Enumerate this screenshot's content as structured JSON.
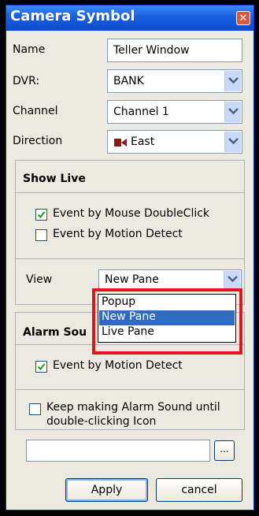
{
  "window": {
    "title": "Camera Symbol",
    "close_glyph": "✕"
  },
  "fields": {
    "name": {
      "label": "Name",
      "value": "Teller Window"
    },
    "dvr": {
      "label": "DVR:",
      "value": "BANK"
    },
    "channel": {
      "label": "Channel",
      "value": "Channel 1"
    },
    "direction": {
      "label": "Direction",
      "value": "East",
      "icon": "camera-direction-icon",
      "icon_color": "#8b1a1a"
    }
  },
  "show_live": {
    "title": "Show Live",
    "checks": [
      {
        "label": "Event by Mouse DoubleClick",
        "checked": true
      },
      {
        "label": "Event by Motion Detect",
        "checked": false
      }
    ],
    "view": {
      "label": "View",
      "value": "New Pane"
    },
    "view_options": [
      "Popup",
      "New Pane",
      "Live Pane"
    ],
    "view_selected": "New Pane"
  },
  "alarm": {
    "title": "Alarm Sou",
    "check": {
      "label": "Event by Motion Detect",
      "checked": true
    },
    "keep_check": {
      "label_line1": "Keep making Alarm Sound until",
      "label_line2": "double-clicking Icon",
      "checked": false
    },
    "sound_file": "",
    "browse_label": "..."
  },
  "buttons": {
    "apply": "Apply",
    "cancel": "cancel"
  },
  "colors": {
    "titlebar": "#0a4ad0",
    "selection": "#316ac5",
    "highlight_box": "#e8121f"
  }
}
